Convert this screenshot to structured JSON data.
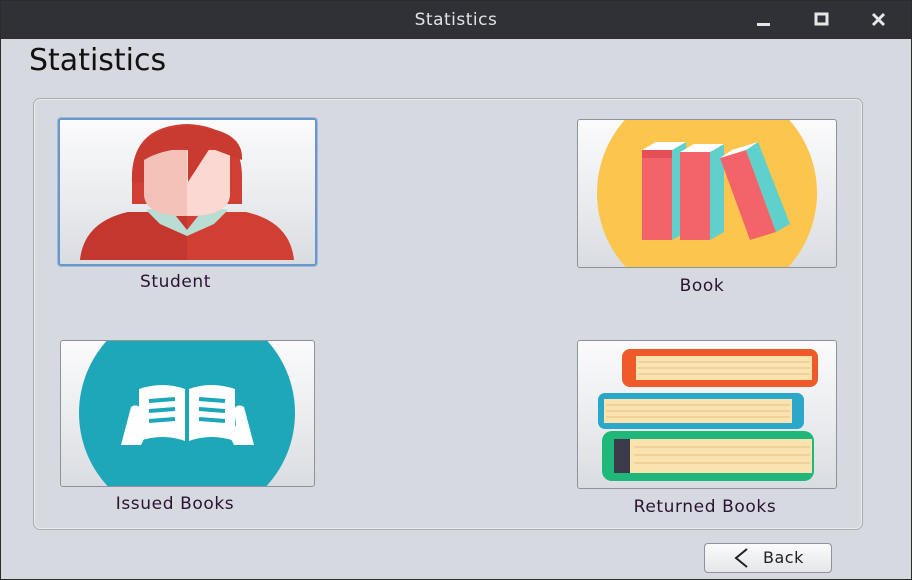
{
  "window": {
    "title": "Statistics"
  },
  "page": {
    "heading": "Statistics"
  },
  "tiles": [
    {
      "label": "Student",
      "icon": "student-avatar-icon"
    },
    {
      "label": "Book",
      "icon": "books-icon"
    },
    {
      "label": "Issued Books",
      "icon": "open-book-icon"
    },
    {
      "label": "Returned Books",
      "icon": "book-stack-icon"
    }
  ],
  "back_button": {
    "label": "Back",
    "icon": "chevron-left-icon"
  },
  "colors": {
    "titlebar": "#2f3136",
    "background": "#d6d9df",
    "student_shirt": "#d13f34",
    "book_circle": "#fcc54e",
    "issued_circle": "#1ea7b8"
  }
}
